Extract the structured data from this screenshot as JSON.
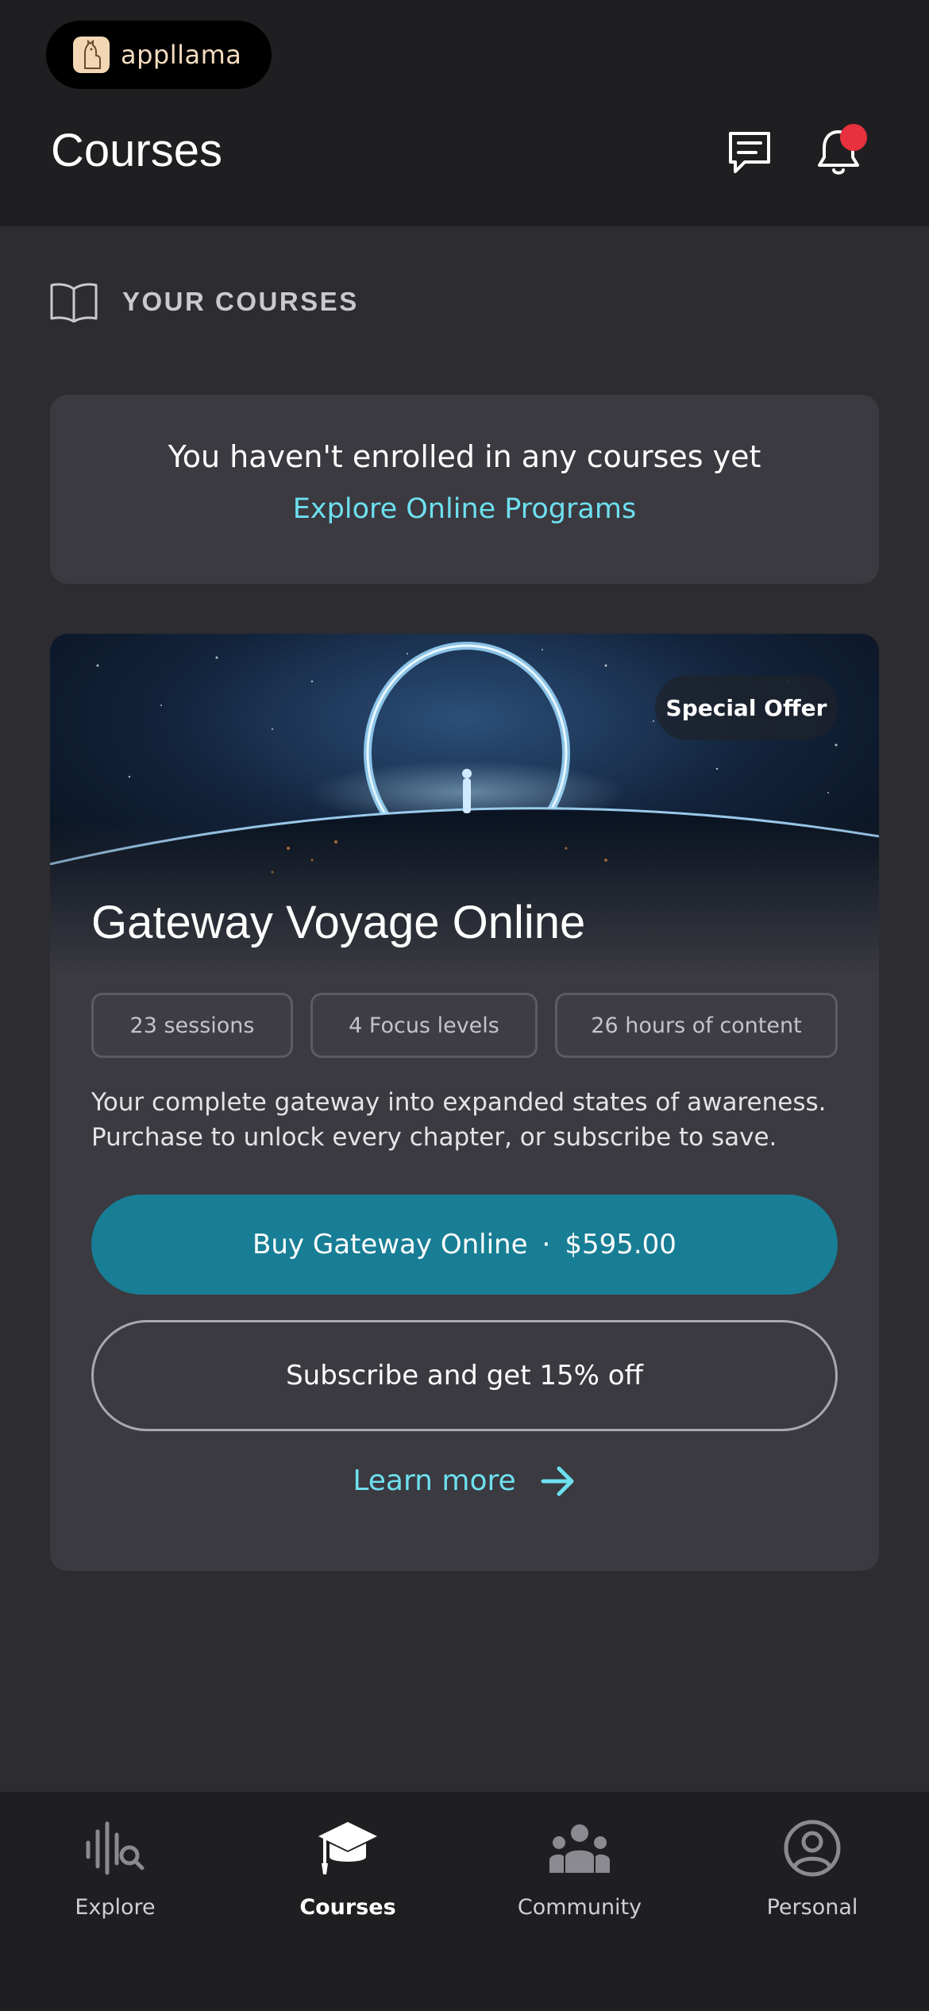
{
  "app": {
    "brand_name": "appllama",
    "brand_color": "#f4dcc0"
  },
  "header": {
    "title": "Courses",
    "chat_icon": "chat-icon",
    "bell_icon": "bell-icon",
    "notification_dot_color": "#e8313e"
  },
  "section": {
    "icon": "book-open-icon",
    "label": "YOUR COURSES"
  },
  "empty_state": {
    "message": "You haven't enrolled in any courses yet",
    "link": "Explore Online Programs"
  },
  "offer": {
    "badge": "Special Offer",
    "title": "Gateway Voyage Online",
    "chips": [
      "23 sessions",
      "4 Focus levels",
      "26 hours of content"
    ],
    "description": "Your complete gateway into expanded states of awareness. Purchase to unlock every chapter, or subscribe to save.",
    "buy_label": "Buy Gateway Online",
    "separator": "·",
    "price": "$595.00",
    "subscribe_label": "Subscribe and get 15% off",
    "learn_more": "Learn more",
    "accent_color": "#187e95",
    "link_color": "#6ee0f0"
  },
  "tabbar": {
    "active": "Courses",
    "tabs": [
      {
        "label": "Explore",
        "icon": "waveform-search-icon"
      },
      {
        "label": "Courses",
        "icon": "graduation-cap-icon"
      },
      {
        "label": "Community",
        "icon": "people-icon"
      },
      {
        "label": "Personal",
        "icon": "person-circle-icon"
      }
    ]
  }
}
